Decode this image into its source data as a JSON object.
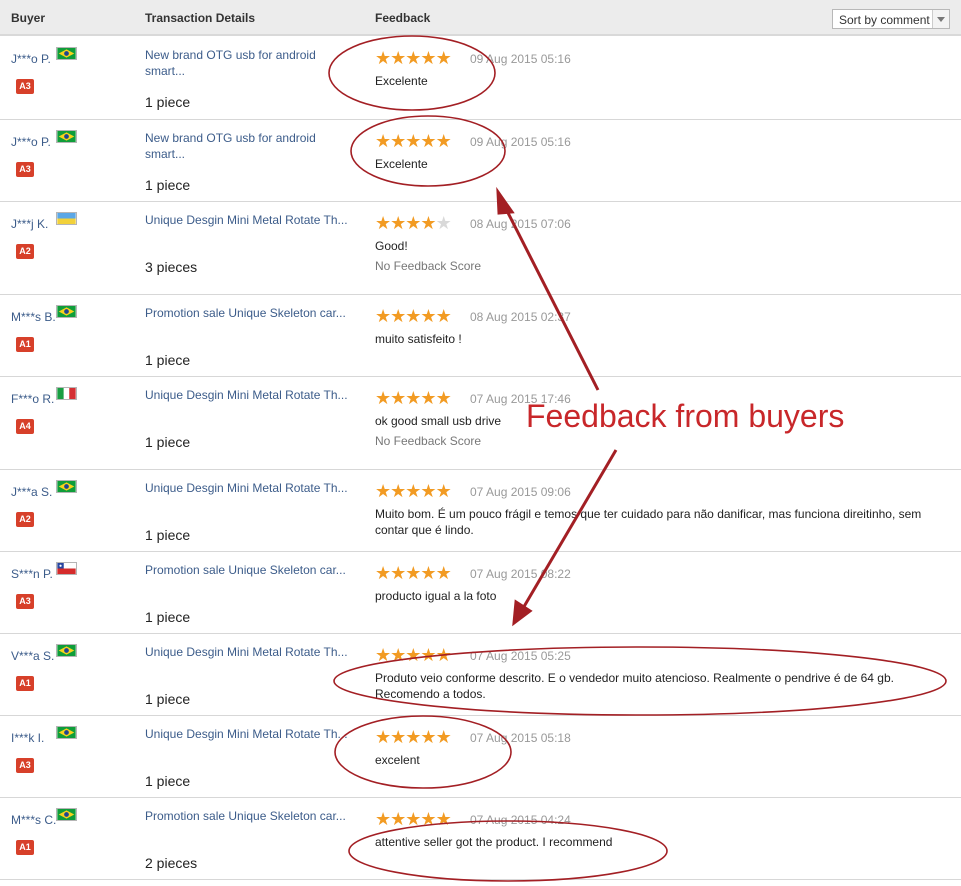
{
  "header": {
    "buyer": "Buyer",
    "transaction": "Transaction Details",
    "feedback": "Feedback",
    "sort_label": "Sort by comment"
  },
  "rows": [
    {
      "buyer": "J***o P.",
      "flag": "brazil",
      "badge": "A3",
      "product": "New brand OTG usb for android smart...",
      "qty": "1 piece",
      "stars": 5,
      "date": "09 Aug 2015 05:16",
      "comment": "Excelente",
      "no_score": ""
    },
    {
      "buyer": "J***o P.",
      "flag": "brazil",
      "badge": "A3",
      "product": "New brand OTG usb for android smart...",
      "qty": "1 piece",
      "stars": 5,
      "date": "09 Aug 2015 05:16",
      "comment": "Excelente",
      "no_score": ""
    },
    {
      "buyer": "J***j K.",
      "flag": "ukraine",
      "badge": "A2",
      "product": "Unique Desgin Mini Metal Rotate Th...",
      "qty": "3 pieces",
      "stars": 4,
      "date": "08 Aug 2015 07:06",
      "comment": "Good!",
      "no_score": "No Feedback Score"
    },
    {
      "buyer": "M***s B.",
      "flag": "brazil",
      "badge": "A1",
      "product": "Promotion sale Unique Skeleton car...",
      "qty": "1 piece",
      "stars": 5,
      "date": "08 Aug 2015 02:37",
      "comment": "muito satisfeito !",
      "no_score": ""
    },
    {
      "buyer": "F***o R.",
      "flag": "italy",
      "badge": "A4",
      "product": "Unique Desgin Mini Metal Rotate Th...",
      "qty": "1 piece",
      "stars": 5,
      "date": "07 Aug 2015 17:46",
      "comment": "ok good small usb drive",
      "no_score": "No Feedback Score"
    },
    {
      "buyer": "J***a S.",
      "flag": "brazil",
      "badge": "A2",
      "product": "Unique Desgin Mini Metal Rotate Th...",
      "qty": "1 piece",
      "stars": 5,
      "date": "07 Aug 2015 09:06",
      "comment": "Muito bom. É um pouco frágil e temos que ter cuidado para não danificar, mas funciona direitinho, sem contar que é lindo.",
      "no_score": ""
    },
    {
      "buyer": "S***n P.",
      "flag": "chile",
      "badge": "A3",
      "product": "Promotion sale Unique Skeleton car...",
      "qty": "1 piece",
      "stars": 5,
      "date": "07 Aug 2015 08:22",
      "comment": "producto igual a la foto",
      "no_score": ""
    },
    {
      "buyer": "V***a S.",
      "flag": "brazil",
      "badge": "A1",
      "product": "Unique Desgin Mini Metal Rotate Th...",
      "qty": "1 piece",
      "stars": 5,
      "date": "07 Aug 2015 05:25",
      "comment": "Produto veio conforme descrito. E o vendedor muito atencioso. Realmente o pendrive é de 64 gb. Recomendo a todos.",
      "no_score": ""
    },
    {
      "buyer": "I***k I.",
      "flag": "brazil",
      "badge": "A3",
      "product": "Unique Desgin Mini Metal Rotate Th...",
      "qty": "1 piece",
      "stars": 5,
      "date": "07 Aug 2015 05:18",
      "comment": "excelent",
      "no_score": ""
    },
    {
      "buyer": "M***s C.",
      "flag": "brazil",
      "badge": "A1",
      "product": "Promotion sale Unique Skeleton car...",
      "qty": "2 pieces",
      "stars": 5,
      "date": "07 Aug 2015 04:24",
      "comment": "attentive seller got the product. I recommend",
      "no_score": ""
    }
  ],
  "annotation": {
    "text": "Feedback from buyers",
    "color": "#c8272a"
  },
  "colors": {
    "link": "#3c5c8a",
    "star": "#f29b23",
    "badge": "#d7402a",
    "annotation": "#c8272a"
  }
}
